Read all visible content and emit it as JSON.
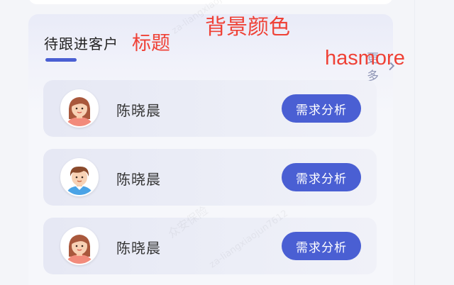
{
  "panel": {
    "title": "待跟进客户",
    "more_label": "更多",
    "more_icon": "chevron-right-icon",
    "accent_color": "#4a5fd3"
  },
  "annotations": {
    "title": "标题",
    "background": "背景颜色",
    "hasmore": "hasmore",
    "color": "#ef4136"
  },
  "watermark": {
    "line1": "众安保险",
    "line2": "za-liangxiaojun7612"
  },
  "customers": [
    {
      "name": "陈晓晨",
      "action": "需求分析",
      "avatar": "female-avatar-icon"
    },
    {
      "name": "陈晓晨",
      "action": "需求分析",
      "avatar": "male-avatar-icon"
    },
    {
      "name": "陈晓晨",
      "action": "需求分析",
      "avatar": "female-avatar-icon"
    }
  ]
}
